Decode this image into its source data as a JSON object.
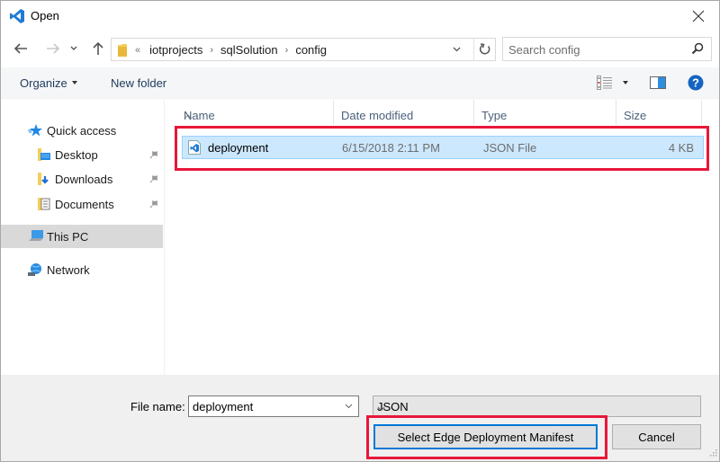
{
  "window": {
    "title": "Open",
    "icons": {
      "app": "vscode-icon",
      "close": "close-icon"
    }
  },
  "navigation": {
    "back_icon": "arrow-left-icon",
    "forward_icon": "arrow-right-icon",
    "recent_icon": "chevron-down-icon",
    "up_icon": "arrow-up-icon",
    "breadcrumb_overflow": "«",
    "breadcrumbs": [
      "iotprojects",
      "sqlSolution",
      "config"
    ],
    "refresh_icon": "refresh-icon",
    "search_placeholder": "Search config",
    "search_value": ""
  },
  "commandbar": {
    "organize_label": "Organize",
    "new_folder_label": "New folder",
    "view_icon": "details-view-icon",
    "preview_pane_icon": "preview-pane-icon",
    "help_icon": "help-icon"
  },
  "sidebar": {
    "items": [
      {
        "label": "Quick access",
        "icon": "star-icon",
        "pinned": false,
        "selected": false
      },
      {
        "label": "Desktop",
        "icon": "desktop-folder-icon",
        "pinned": true,
        "selected": false
      },
      {
        "label": "Downloads",
        "icon": "downloads-folder-icon",
        "pinned": true,
        "selected": false
      },
      {
        "label": "Documents",
        "icon": "documents-folder-icon",
        "pinned": true,
        "selected": false
      },
      {
        "label": "This PC",
        "icon": "computer-icon",
        "pinned": false,
        "selected": true
      },
      {
        "label": "Network",
        "icon": "network-icon",
        "pinned": false,
        "selected": false
      }
    ]
  },
  "filelist": {
    "columns": [
      "Name",
      "Date modified",
      "Type",
      "Size"
    ],
    "sort_column": "Name",
    "rows": [
      {
        "name": "deployment",
        "date_modified": "6/15/2018 2:11 PM",
        "type": "JSON File",
        "size": "4 KB",
        "icon": "vscode-json-file-icon",
        "selected": true
      }
    ]
  },
  "footer": {
    "filename_label": "File name:",
    "filename_value": "deployment",
    "filetype_value": "JSON",
    "primary_button": "Select Edge Deployment Manifest",
    "cancel_button": "Cancel"
  },
  "annotations": {
    "highlight_color": "#e8173a"
  }
}
